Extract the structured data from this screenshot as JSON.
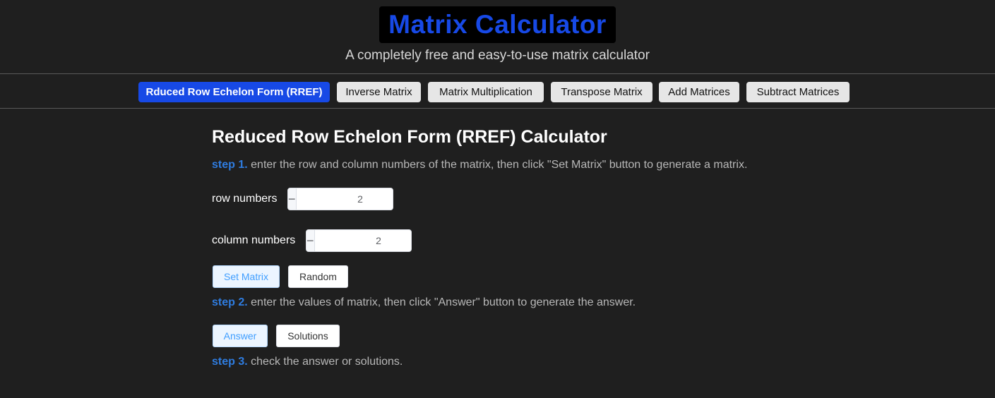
{
  "header": {
    "logo_text": "Matrix Calculator",
    "subtitle": "A completely free and easy-to-use matrix calculator"
  },
  "nav": {
    "items": [
      {
        "label": "Rduced Row Echelon Form (RREF)",
        "active": true
      },
      {
        "label": "Inverse Matrix",
        "active": false
      },
      {
        "label": "Matrix Multiplication",
        "active": false
      },
      {
        "label": "Transpose Matrix",
        "active": false
      },
      {
        "label": "Add Matrices",
        "active": false
      },
      {
        "label": "Subtract Matrices",
        "active": false
      }
    ]
  },
  "main": {
    "title": "Reduced Row Echelon Form (RREF) Calculator",
    "step1": {
      "label": "step 1.",
      "text": "enter the row and column numbers of the matrix, then click \"Set Matrix\" button to generate a matrix."
    },
    "rows": {
      "label": "row numbers",
      "value": "2",
      "minus": "−",
      "plus": "+"
    },
    "columns": {
      "label": "column numbers",
      "value": "2",
      "minus": "−",
      "plus": "+"
    },
    "set_matrix_label": "Set Matrix",
    "random_label": "Random",
    "step2": {
      "label": "step 2.",
      "text": "enter the values of matrix, then click \"Answer\" button to generate the answer."
    },
    "answer_label": "Answer",
    "solutions_label": "Solutions",
    "step3": {
      "label": "step 3.",
      "text": "check the answer or solutions."
    }
  },
  "colors": {
    "background": "#1f1f1f",
    "accent_blue": "#1749e6",
    "step_blue": "#2f7de1"
  }
}
